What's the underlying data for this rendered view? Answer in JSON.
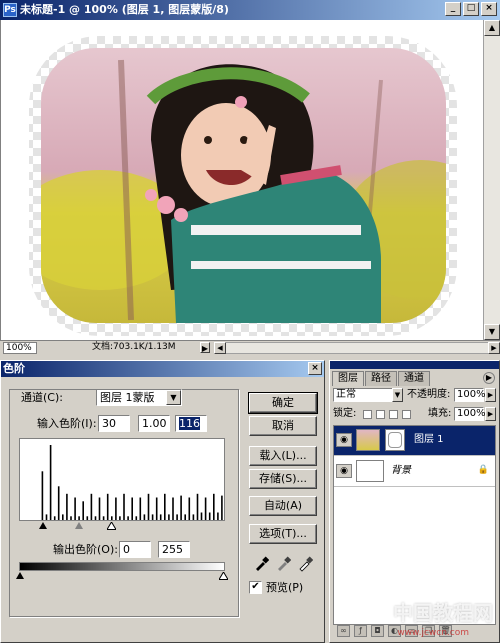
{
  "document": {
    "title": "未标题-1 @ 100% (图层 1, 图层蒙版/8)",
    "zoom": "100%",
    "doc_info": "文档:703.1K/1.13M",
    "icons": {
      "app": "ps-doc-icon",
      "minimize": "minimize-icon",
      "maximize": "maximize-icon",
      "close": "close-icon"
    }
  },
  "levels": {
    "title": "色阶",
    "channel_label": "通道(C):",
    "channel_value": "图层 1蒙版",
    "input_label": "输入色阶(I):",
    "input_black": "30",
    "input_gamma": "1.00",
    "input_white": "116",
    "output_label": "输出色阶(O):",
    "output_black": "0",
    "output_white": "255",
    "buttons": {
      "ok": "确定",
      "cancel": "取消",
      "load": "载入(L)...",
      "save": "存储(S)...",
      "auto": "自动(A)",
      "options": "选项(T)..."
    },
    "preview_label": "预览(P)",
    "preview_checked": "✔",
    "histogram": [
      0,
      0,
      0,
      0,
      0,
      26,
      3,
      40,
      2,
      18,
      3,
      14,
      2,
      12,
      2,
      10,
      2,
      14,
      2,
      12,
      2,
      14,
      2,
      12,
      2,
      14,
      2,
      12,
      2,
      12,
      3,
      14,
      3,
      12,
      3,
      14,
      3,
      12,
      3,
      13,
      3,
      12,
      3,
      14,
      4,
      12,
      4,
      14,
      4,
      13
    ]
  },
  "layers": {
    "tabs": [
      "图层",
      "路径",
      "通道"
    ],
    "blend_mode": "正常",
    "opacity_label": "不透明度:",
    "opacity_value": "100%",
    "lock_label": "锁定:",
    "fill_label": "填充:",
    "fill_value": "100%",
    "items": [
      {
        "name": "图层 1",
        "selected": true
      },
      {
        "name": "背景",
        "selected": false
      }
    ]
  },
  "watermark": {
    "text": "中国教程网",
    "url": "www.jcwcn.com"
  },
  "colors": {
    "title_start": "#0a246a",
    "title_end": "#a6caf0",
    "panel": "#d4d0c8",
    "selection": "#0a246a"
  }
}
